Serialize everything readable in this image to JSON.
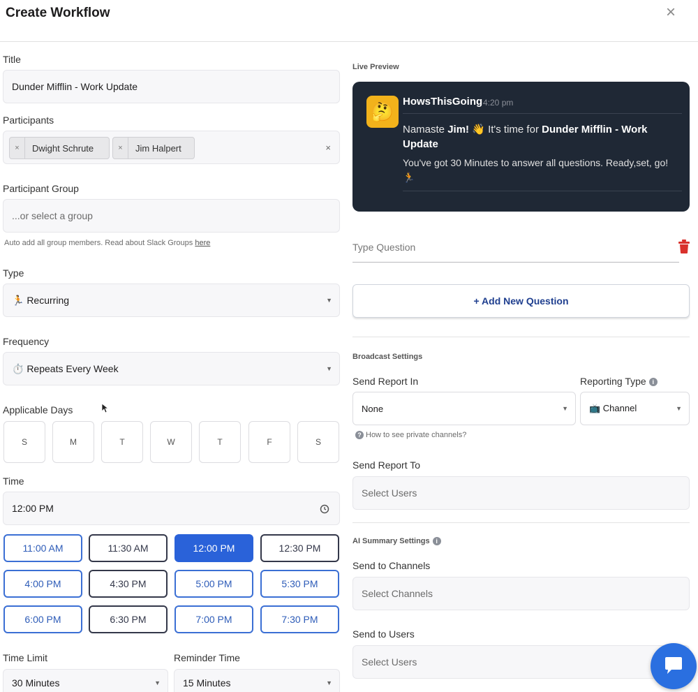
{
  "header": {
    "title": "Create Workflow",
    "close_icon": "×"
  },
  "left": {
    "title_label": "Title",
    "title_value": "Dunder Mifflin - Work Update",
    "participants_label": "Participants",
    "participants": [
      "Dwight Schrute",
      "Jim Halpert"
    ],
    "participants_clear": "×",
    "group_label": "Participant Group",
    "group_placeholder": "...or select a group",
    "group_hint": "Auto add all group members. Read about Slack Groups",
    "group_hint_link": "here",
    "type_label": "Type",
    "type_value": "🏃 Recurring",
    "frequency_label": "Frequency",
    "frequency_value": "⏱️ Repeats Every Week",
    "days_label": "Applicable Days",
    "days": [
      "S",
      "M",
      "T",
      "W",
      "T",
      "F",
      "S"
    ],
    "time_label": "Time",
    "time_value": "12:00 PM",
    "time_slots": [
      {
        "label": "11:00 AM",
        "state": "blue"
      },
      {
        "label": "11:30 AM",
        "state": "dark"
      },
      {
        "label": "12:00 PM",
        "state": "selected"
      },
      {
        "label": "12:30 PM",
        "state": "dark"
      },
      {
        "label": "4:00 PM",
        "state": "blue"
      },
      {
        "label": "4:30 PM",
        "state": "dark"
      },
      {
        "label": "5:00 PM",
        "state": "blue"
      },
      {
        "label": "5:30 PM",
        "state": "blue"
      },
      {
        "label": "6:00 PM",
        "state": "blue"
      },
      {
        "label": "6:30 PM",
        "state": "dark"
      },
      {
        "label": "7:00 PM",
        "state": "blue"
      },
      {
        "label": "7:30 PM",
        "state": "blue"
      }
    ],
    "time_limit_label": "Time Limit",
    "time_limit_value": "30 Minutes",
    "reminder_label": "Reminder Time",
    "reminder_value": "15 Minutes"
  },
  "right": {
    "live_preview_label": "Live Preview",
    "preview": {
      "avatar": "🤔",
      "bot_name": "HowsThisGoing",
      "time": "4:20 pm",
      "line1_pre": "Namaste",
      "line1_name": "Jim!",
      "line1_mid": "👋 It's time for",
      "line1_bold": "Dunder Mifflin - Work Update",
      "line2": "You've got 30 Minutes to answer all questions. Ready,set, go! 🏃"
    },
    "question_placeholder": "Type Question",
    "add_question": "+ Add New Question",
    "broadcast_label": "Broadcast Settings",
    "send_report_in_label": "Send Report In",
    "send_report_in_value": "None",
    "reporting_type_label": "Reporting Type",
    "reporting_type_value": "📺 Channel",
    "private_channels_hint": "How to see private channels?",
    "send_report_to_label": "Send Report To",
    "send_report_to_placeholder": "Select Users",
    "ai_summary_label": "AI Summary Settings",
    "send_to_channels_label": "Send to Channels",
    "send_to_channels_placeholder": "Select Channels",
    "send_to_users_label": "Send to Users",
    "send_to_users_placeholder": "Select Users"
  },
  "colors": {
    "accent": "#2a62d9",
    "preview_bg": "#1f2835",
    "danger": "#d9312c"
  }
}
